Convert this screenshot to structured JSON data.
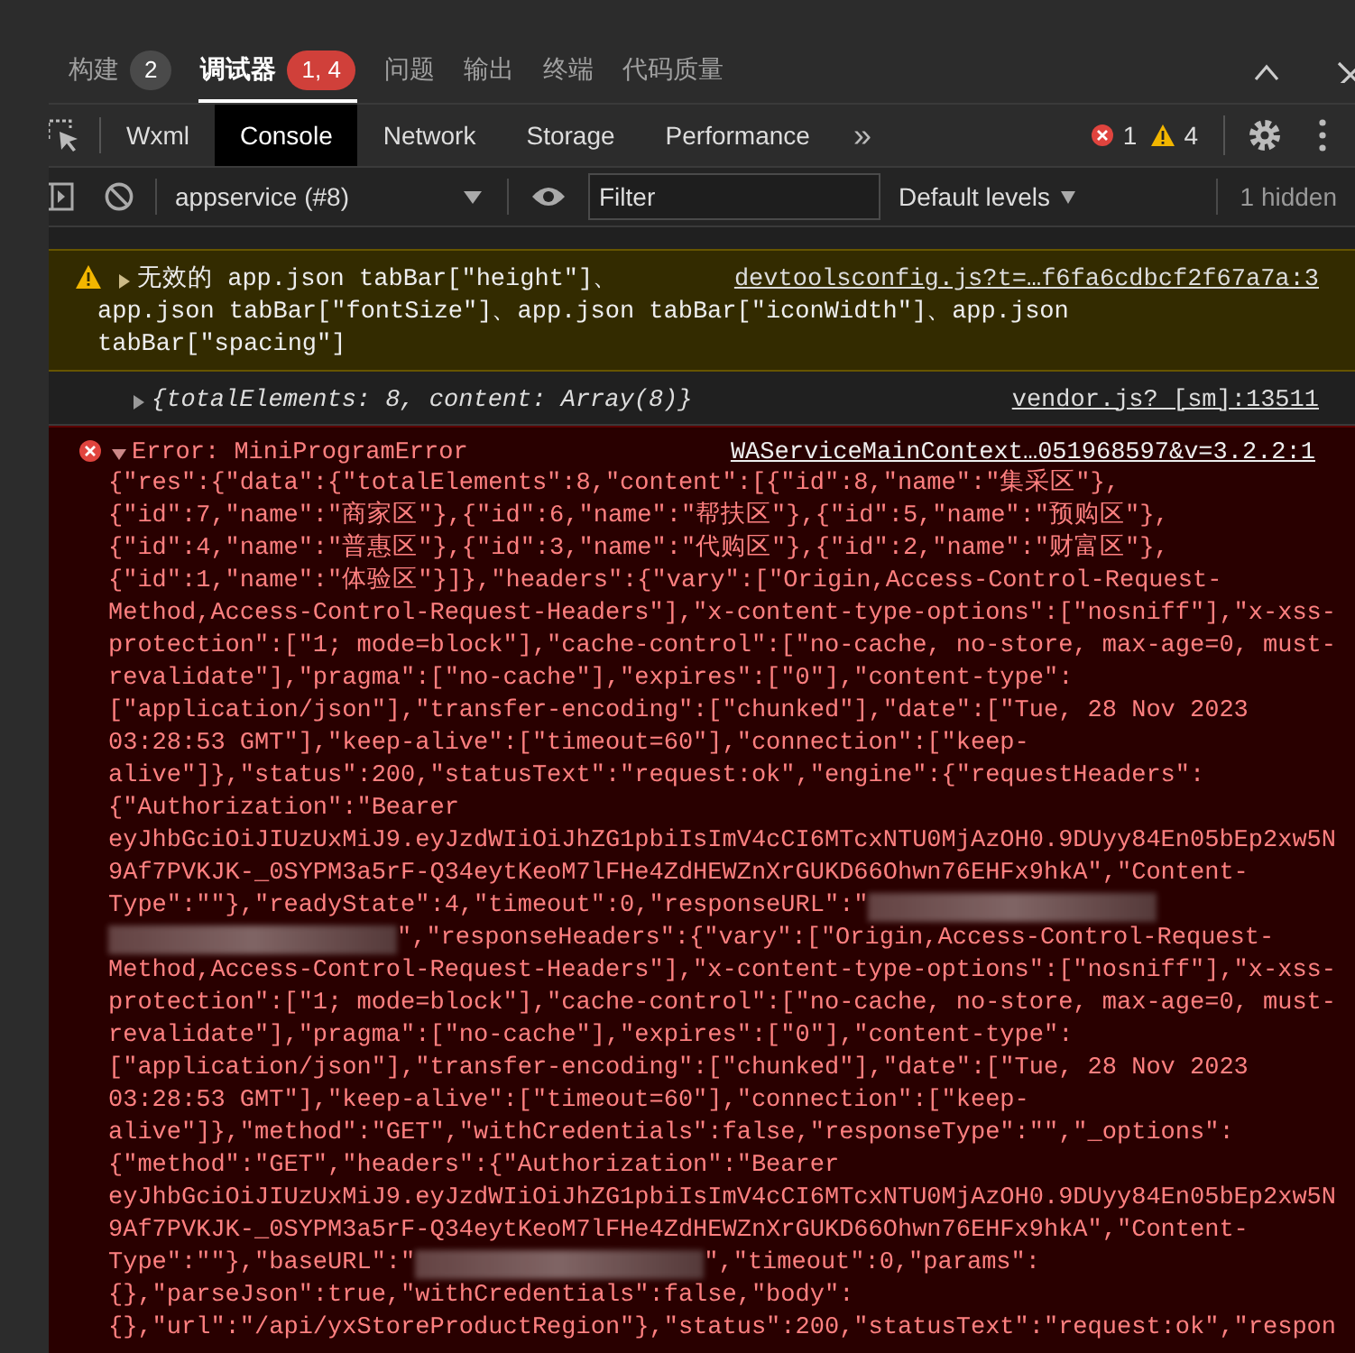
{
  "panel_tabs": [
    {
      "label": "构建",
      "badge": "2",
      "color": "#4a4a4a",
      "selected": false
    },
    {
      "label": "调试器",
      "badge": "1, 4",
      "color": "#d0403a",
      "selected": true
    },
    {
      "label": "问题",
      "selected": false
    },
    {
      "label": "输出",
      "selected": false
    },
    {
      "label": "终端",
      "selected": false
    },
    {
      "label": "代码质量",
      "selected": false
    }
  ],
  "devtools_tabs": [
    {
      "label": "Wxml",
      "selected": false
    },
    {
      "label": "Console",
      "selected": true
    },
    {
      "label": "Network",
      "selected": false
    },
    {
      "label": "Storage",
      "selected": false
    },
    {
      "label": "Performance",
      "selected": false
    }
  ],
  "more_tabs": "»",
  "counts": {
    "errors": "1",
    "warnings": "4"
  },
  "console_toolbar": {
    "context": "appservice (#8)",
    "filter_placeholder": "Filter",
    "levels": "Default levels",
    "hidden": "1 hidden"
  },
  "messages": [
    {
      "kind": "warning",
      "lines": [
        "无效的 app.json tabBar[\"height\"]、",
        "app.json tabBar[\"fontSize\"]、app.json tabBar[\"iconWidth\"]、app.json",
        "tabBar[\"spacing\"]"
      ],
      "source": "devtoolsconfig.js?t=…f6fa6cdbcf2f67a7a:3"
    },
    {
      "kind": "log",
      "text": "{totalElements: 8, content: Array(8)}",
      "source": "vendor.js? [sm]:13511"
    },
    {
      "kind": "error",
      "title": "Error: MiniProgramError",
      "source": "WAServiceMainContext…051968597&v=3.2.2:1",
      "lines": [
        "{\"res\":{\"data\":{\"totalElements\":8,\"content\":[{\"id\":8,\"name\":\"集采区\"},",
        "{\"id\":7,\"name\":\"商家区\"},{\"id\":6,\"name\":\"帮扶区\"},{\"id\":5,\"name\":\"预购区\"},",
        "{\"id\":4,\"name\":\"普惠区\"},{\"id\":3,\"name\":\"代购区\"},{\"id\":2,\"name\":\"财富区\"},",
        "{\"id\":1,\"name\":\"体验区\"}]},\"headers\":{\"vary\":[\"Origin,Access-Control-Request-",
        "Method,Access-Control-Request-Headers\"],\"x-content-type-options\":[\"nosniff\"],\"x-xss-",
        "protection\":[\"1; mode=block\"],\"cache-control\":[\"no-cache, no-store, max-age=0, must-",
        "revalidate\"],\"pragma\":[\"no-cache\"],\"expires\":[\"0\"],\"content-type\":",
        "[\"application/json\"],\"transfer-encoding\":[\"chunked\"],\"date\":[\"Tue, 28 Nov 2023",
        "03:28:53 GMT\"],\"keep-alive\":[\"timeout=60\"],\"connection\":[\"keep-",
        "alive\"]},\"status\":200,\"statusText\":\"request:ok\",\"engine\":{\"requestHeaders\":",
        "{\"Authorization\":\"Bearer",
        "eyJhbGciOiJIUzUxMiJ9.eyJzdWIiOiJhZG1pbiIsImV4cCI6MTcxNTU0MjAzOH0.9DUyy84En05bEp2xw5N",
        "9Af7PVKJK-_0SYPM3a5rF-Q34eytKeoM7lFHe4ZdHEWZnXrGUKD66Ohwn76EHFx9hkA\",\"Content-",
        {
          "kind": "redacted",
          "before": "Type\":\"\"},\"readyState\":4,\"timeout\":0,\"responseURL\":\""
        },
        {
          "kind": "redacted",
          "after": "\",\"responseHeaders\":{\"vary\":[\"Origin,Access-Control-Request-"
        },
        "Method,Access-Control-Request-Headers\"],\"x-content-type-options\":[\"nosniff\"],\"x-xss-",
        "protection\":[\"1; mode=block\"],\"cache-control\":[\"no-cache, no-store, max-age=0, must-",
        "revalidate\"],\"pragma\":[\"no-cache\"],\"expires\":[\"0\"],\"content-type\":",
        "[\"application/json\"],\"transfer-encoding\":[\"chunked\"],\"date\":[\"Tue, 28 Nov 2023",
        "03:28:53 GMT\"],\"keep-alive\":[\"timeout=60\"],\"connection\":[\"keep-",
        "alive\"]},\"method\":\"GET\",\"withCredentials\":false,\"responseType\":\"\",\"_options\":",
        "{\"method\":\"GET\",\"headers\":{\"Authorization\":\"Bearer",
        "eyJhbGciOiJIUzUxMiJ9.eyJzdWIiOiJhZG1pbiIsImV4cCI6MTcxNTU0MjAzOH0.9DUyy84En05bEp2xw5N",
        "9Af7PVKJK-_0SYPM3a5rF-Q34eytKeoM7lFHe4ZdHEWZnXrGUKD66Ohwn76EHFx9hkA\",\"Content-",
        {
          "kind": "redacted",
          "before": "Type\":\"\"},\"baseURL\":\"",
          "after": "\",\"timeout\":0,\"params\":"
        },
        "{},\"parseJson\":true,\"withCredentials\":false,\"body\":",
        "{},\"url\":\"/api/yxStoreProductRegion\"},\"status\":200,\"statusText\":\"request:ok\",\"respon"
      ]
    }
  ]
}
